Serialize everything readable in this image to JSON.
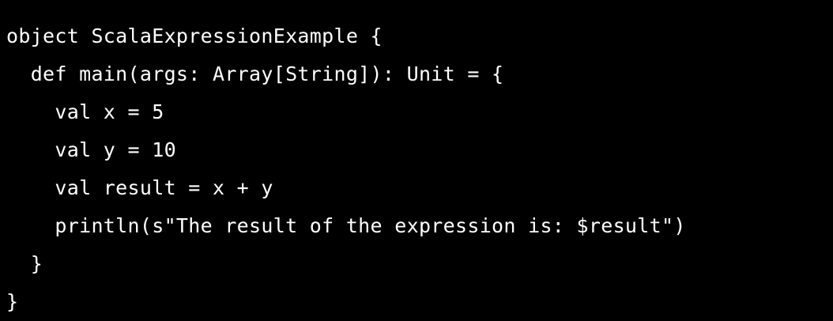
{
  "code": {
    "lines": [
      "object ScalaExpressionExample {",
      "  def main(args: Array[String]): Unit = {",
      "    val x = 5",
      "    val y = 10",
      "    val result = x + y",
      "    println(s\"The result of the expression is: $result\")",
      "  }",
      "}"
    ]
  }
}
